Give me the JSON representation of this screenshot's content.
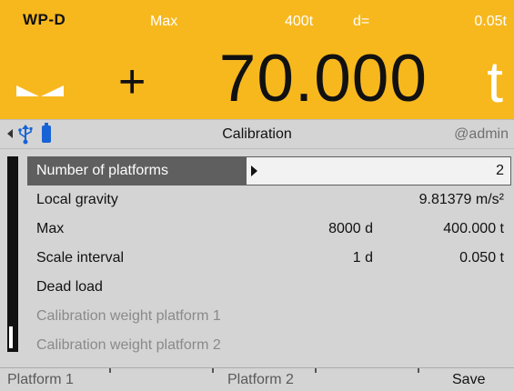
{
  "display": {
    "device_name": "WP-D",
    "max_label": "Max",
    "capacity": "400t",
    "d_label": "d=",
    "interval": "0.05t",
    "sign": "+",
    "weight": "70.000",
    "unit": "t"
  },
  "header": {
    "title": "Calibration",
    "user": "@admin"
  },
  "menu": {
    "rows": [
      {
        "label": "Number of platforms",
        "value1": "",
        "value2": "2"
      },
      {
        "label": "Local gravity",
        "value1": "",
        "value2": "9.81379 m/s²"
      },
      {
        "label": "Max",
        "value1": "8000 d",
        "value2": "400.000 t"
      },
      {
        "label": "Scale interval",
        "value1": "1 d",
        "value2": "0.050 t"
      },
      {
        "label": "Dead load",
        "value1": "",
        "value2": ""
      },
      {
        "label": "Calibration weight platform 1",
        "value1": "",
        "value2": ""
      },
      {
        "label": "Calibration weight platform 2",
        "value1": "",
        "value2": ""
      }
    ]
  },
  "softkeys": {
    "k1": "Platform 1",
    "k2": "Platform 2",
    "k3": "",
    "k4": "Save"
  },
  "colors": {
    "display_bg": "#f7b81e",
    "panel_bg": "#d4d4d4",
    "selection": "#5f5f5f",
    "battery": "#1763d6"
  },
  "icons": {
    "back": "arrow-left-icon",
    "usb": "usb-icon",
    "battery": "battery-icon",
    "stable_left": "triangle-left-icon",
    "stable_right": "triangle-right-icon"
  }
}
